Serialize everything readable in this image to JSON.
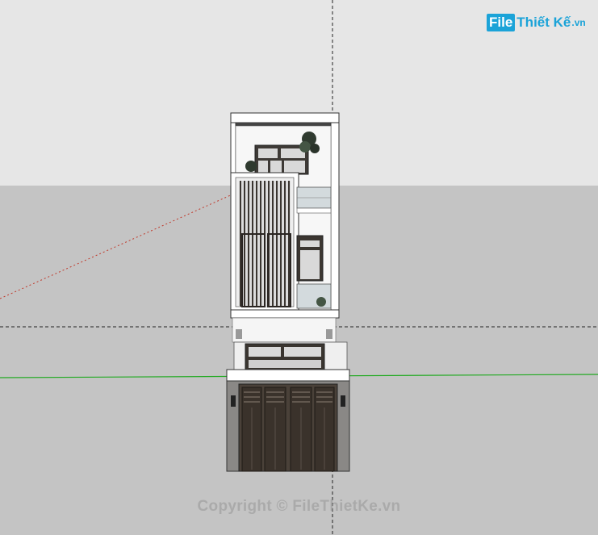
{
  "logo": {
    "box": "File",
    "name": "Thiết Kế",
    "domain": ".vn"
  },
  "watermark": "Copyright © FileThietKe.vn",
  "colors": {
    "sky": "#e4e4e4",
    "ground": "#c6c6c6",
    "red_axis": "#c0392b",
    "green_axis": "#22aa22",
    "blue_axis": "#222222",
    "accent": "#1ba3d8"
  }
}
